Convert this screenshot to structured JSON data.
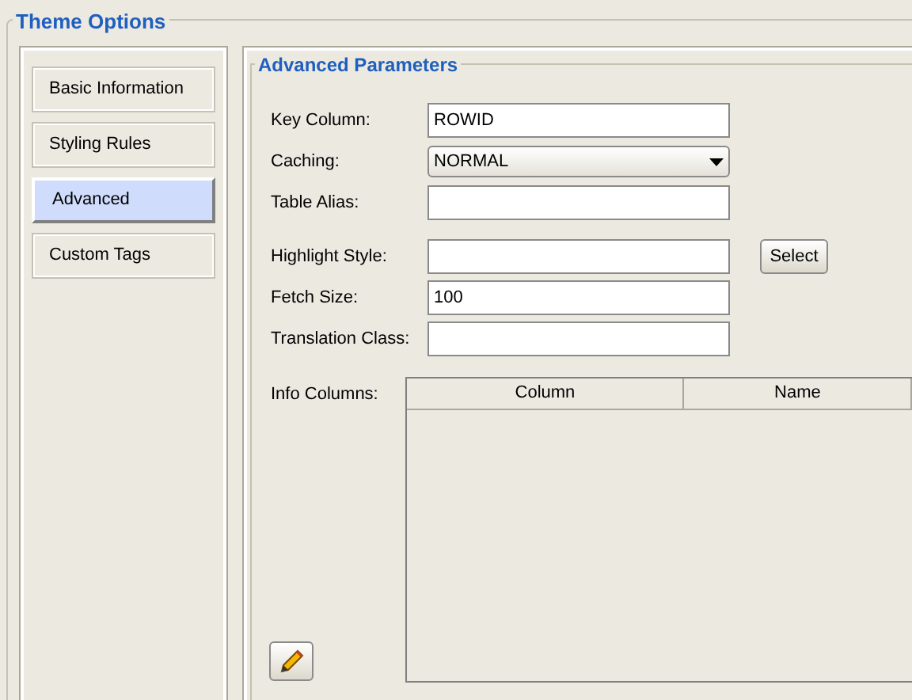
{
  "title": "Theme Options",
  "nav": [
    {
      "label": "Basic Information",
      "selected": false
    },
    {
      "label": "Styling Rules",
      "selected": false
    },
    {
      "label": "Advanced",
      "selected": true
    },
    {
      "label": "Custom Tags",
      "selected": false
    }
  ],
  "section_title": "Advanced Parameters",
  "fields": [
    {
      "kind": "text",
      "label": "Key Column:",
      "value": "ROWID"
    },
    {
      "kind": "select",
      "label": "Caching:",
      "value": "NORMAL"
    },
    {
      "kind": "text",
      "label": "Table Alias:"
    },
    {
      "kind": "text",
      "label": "Highlight Style:",
      "button": "Select"
    },
    {
      "kind": "text",
      "label": "Fetch Size:",
      "value": "100"
    },
    {
      "kind": "text",
      "label": "Translation Class:"
    }
  ],
  "info_columns": {
    "label": "Info Columns:",
    "columns": [
      "Column",
      "Name"
    ]
  }
}
